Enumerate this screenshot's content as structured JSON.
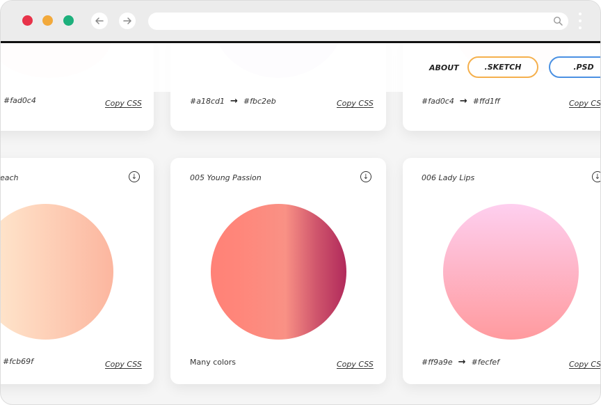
{
  "browser": {
    "traffic_lights": [
      "#e8334a",
      "#f2a93b",
      "#1db07c"
    ],
    "back_icon": "arrow-left-icon",
    "forward_icon": "arrow-right-icon",
    "address_value": "",
    "search_icon": "search-icon",
    "menu_icon": "vertical-dots-icon"
  },
  "nav": {
    "about_label": "ABOUT",
    "sketch_label": ".SKETCH",
    "sketch_color": "#f5b04d",
    "psd_label": ".PSD",
    "psd_color": "#4a90e2"
  },
  "top_cards": [
    {
      "from": "#fad0c4",
      "to": "",
      "copy_label": "Copy CSS",
      "circle": "#fbf1ef"
    },
    {
      "from": "#a18cd1",
      "to": "#fbc2eb",
      "copy_label": "Copy CSS",
      "circle": "#eeebf5"
    },
    {
      "from": "#fad0c4",
      "to": "#ffd1ff",
      "copy_label": "Copy CSS",
      "circle": "#fbf0ef"
    }
  ],
  "bottom_cards": [
    {
      "title": "each",
      "from": "",
      "to": "#fcb69f",
      "copy_label": "Copy CSS",
      "gradient": [
        "#ffecd2",
        "#fcb69f"
      ]
    },
    {
      "title": "005 Young Passion",
      "note": "Many colors",
      "copy_label": "Copy CSS",
      "gradient": [
        "#ff8177",
        "#f99185",
        "#cf556c",
        "#b12a5b"
      ]
    },
    {
      "title": "006 Lady Lips",
      "from": "#ff9a9e",
      "to": "#fecfef",
      "copy_label": "Copy CSS",
      "gradient": [
        "#fecfef",
        "#ff9a9e"
      ]
    }
  ]
}
